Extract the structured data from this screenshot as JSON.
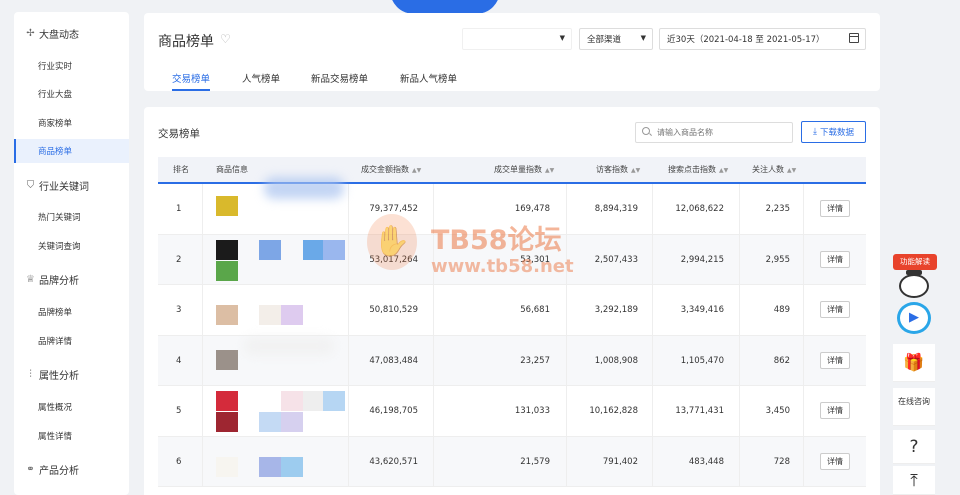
{
  "sidebar": {
    "groups": [
      {
        "icon": "plus-circle-icon",
        "label": "大盘动态",
        "items": [
          "行业实时",
          "行业大盘",
          "商家榜单",
          "商品榜单"
        ]
      },
      {
        "icon": "shield-icon",
        "label": "行业关键词",
        "items": [
          "热门关键词",
          "关键词查询"
        ]
      },
      {
        "icon": "crown-icon",
        "label": "品牌分析",
        "items": [
          "品牌榜单",
          "品牌详情"
        ]
      },
      {
        "icon": "sliders-icon",
        "label": "属性分析",
        "items": [
          "属性概况",
          "属性详情"
        ]
      },
      {
        "icon": "link-icon",
        "label": "产品分析",
        "items": []
      }
    ],
    "active_item": "商品榜单"
  },
  "header": {
    "title": "商品榜单",
    "channel": "全部渠道",
    "date_range": "近30天（2021-04-18 至 2021-05-17）",
    "tabs": [
      "交易榜单",
      "人气榜单",
      "新品交易榜单",
      "新品人气榜单"
    ],
    "active_tab": "交易榜单"
  },
  "main": {
    "title": "交易榜单",
    "search_placeholder": "请输入商品名称",
    "download_label": "下载数据",
    "columns": [
      "排名",
      "商品信息",
      "成交金额指数",
      "成交单量指数",
      "访客指数",
      "搜索点击指数",
      "关注人数"
    ],
    "detail_label": "详情",
    "rows": [
      {
        "rank": "1",
        "amount": "79,377,452",
        "orders": "169,478",
        "visitors": "8,894,319",
        "search": "12,068,622",
        "follows": "2,235",
        "swatches": [
          "#d9b92c"
        ]
      },
      {
        "rank": "2",
        "amount": "53,017,264",
        "orders": "53,301",
        "visitors": "2,507,433",
        "search": "2,994,215",
        "follows": "2,955",
        "swatches": [
          "#1b1b1b",
          "#5aa64a",
          "#7da6e6",
          "#6aa9e8",
          "#9ab7ee"
        ]
      },
      {
        "rank": "3",
        "amount": "50,810,529",
        "orders": "56,681",
        "visitors": "3,292,189",
        "search": "3,349,416",
        "follows": "489",
        "swatches": [
          "#dcbea4",
          "#f3eee9",
          "#decbef"
        ]
      },
      {
        "rank": "4",
        "amount": "47,083,484",
        "orders": "23,257",
        "visitors": "1,008,908",
        "search": "1,105,470",
        "follows": "862",
        "swatches": [
          "#9b918a"
        ]
      },
      {
        "rank": "5",
        "amount": "46,198,705",
        "orders": "131,033",
        "visitors": "10,162,828",
        "search": "13,771,431",
        "follows": "3,450",
        "swatches": [
          "#d42b3b",
          "#9e2631",
          "#f6e2e8",
          "#eeeeee",
          "#b6d6f3",
          "#c4daf4",
          "#d6d0ef"
        ]
      },
      {
        "rank": "6",
        "amount": "43,620,571",
        "orders": "21,579",
        "visitors": "791,402",
        "search": "483,448",
        "follows": "728",
        "swatches": [
          "#f7f5f0",
          "#a7b6e8",
          "#9dccef"
        ]
      }
    ]
  },
  "floating": {
    "tag": "功能解读",
    "consult": "在线咨询",
    "help_icon": "question-icon",
    "top_icon": "back-to-top-icon"
  },
  "watermark": {
    "title": "TB58论坛",
    "url": "www.tb58.net"
  },
  "colors": {
    "accent": "#2a6de5",
    "tag_red": "#e8432b",
    "watermark_orange": "#eb7846"
  }
}
